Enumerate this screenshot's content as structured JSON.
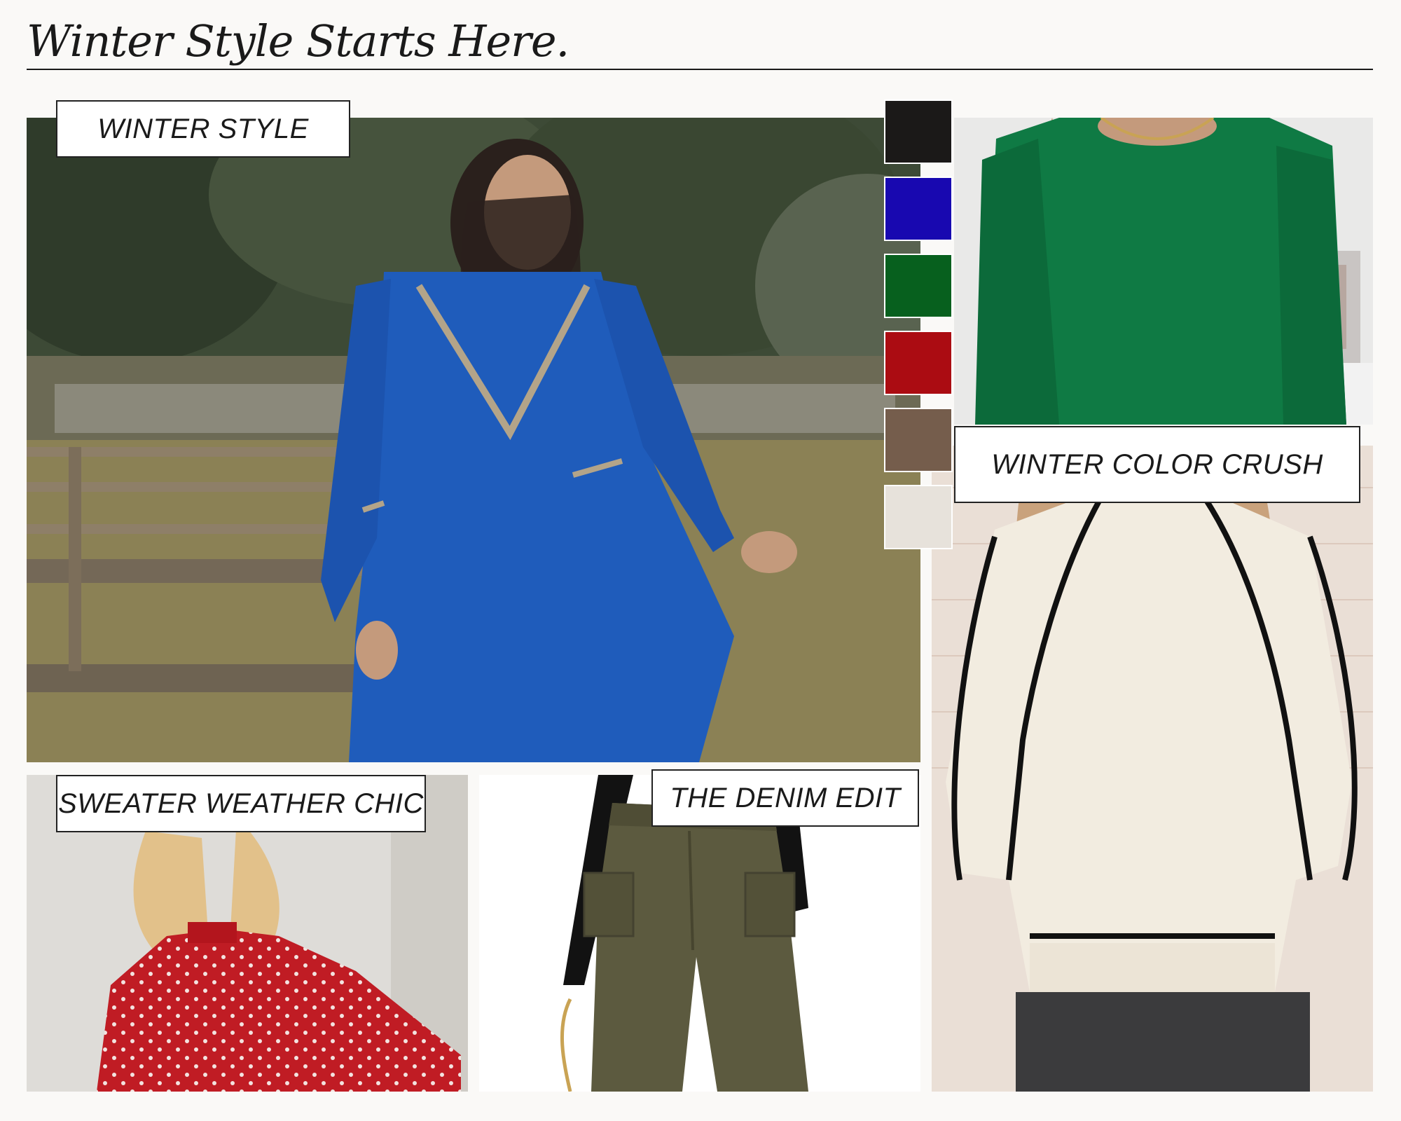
{
  "header": {
    "title": "Winter Style Starts Here."
  },
  "labels": {
    "winter_style": "WINTER STYLE",
    "winter_color_crush": "WINTER COLOR CRUSH",
    "sweater_weather_chic": "SWEATER WEATHER CHIC",
    "the_denim_edit": "THE DENIM EDIT"
  },
  "palette": [
    {
      "name": "black",
      "color": "#1b1918"
    },
    {
      "name": "royal-blue",
      "color": "#1808b0"
    },
    {
      "name": "green",
      "color": "#07601e"
    },
    {
      "name": "red",
      "color": "#ab0c12"
    },
    {
      "name": "brown",
      "color": "#755d4c"
    },
    {
      "name": "cream",
      "color": "#e7e2db"
    }
  ]
}
